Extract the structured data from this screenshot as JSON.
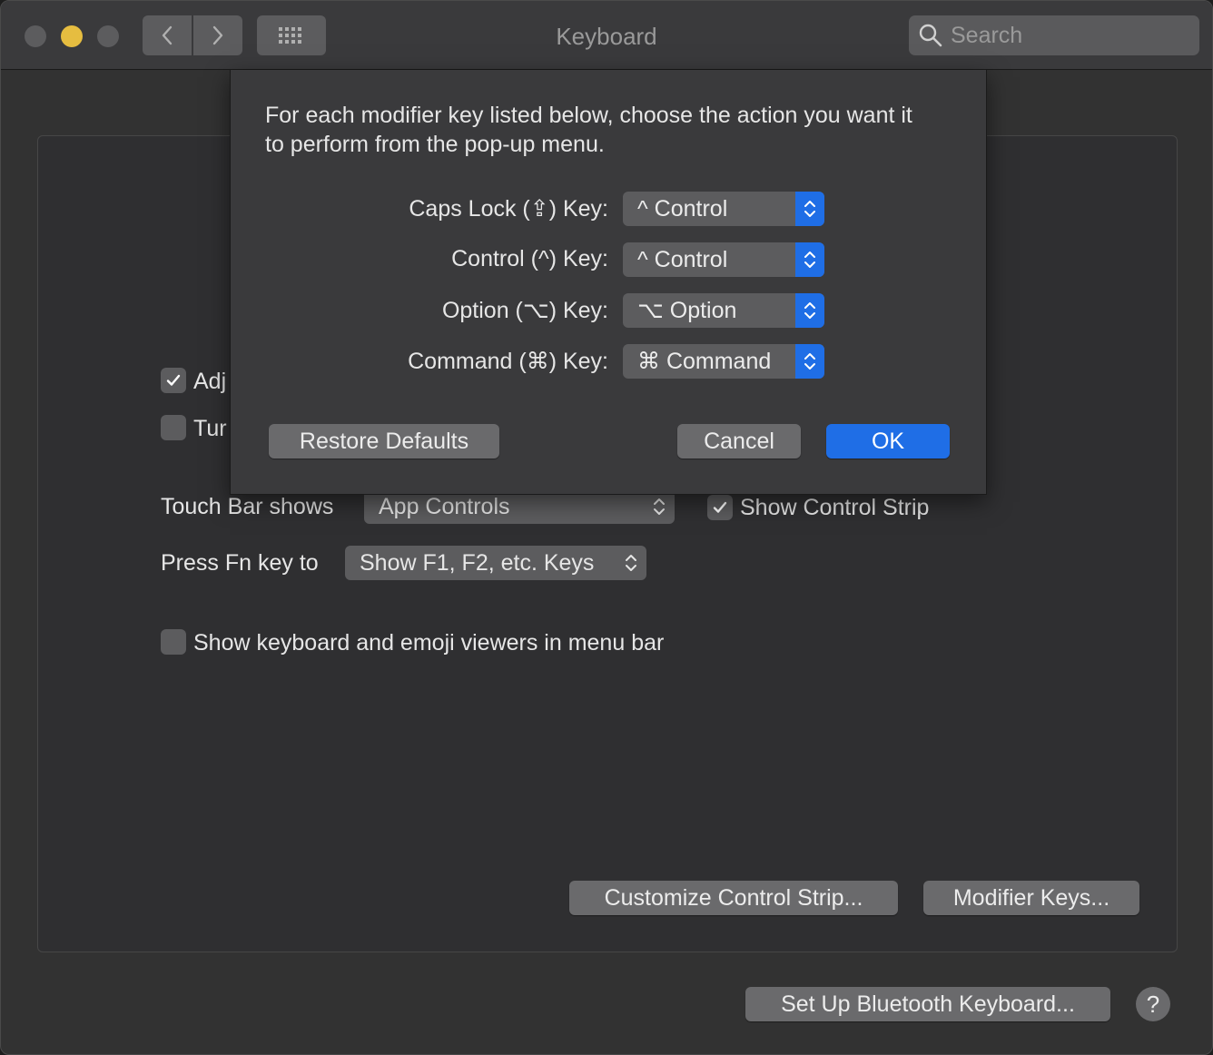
{
  "window": {
    "title": "Keyboard"
  },
  "search": {
    "placeholder": "Search"
  },
  "settings": {
    "adjust_label": "Adj",
    "turn_label": "Tur",
    "touch_bar_label": "Touch Bar shows",
    "touch_bar_value": "App Controls",
    "show_control_strip_label": "Show Control Strip",
    "fn_label": "Press Fn key to",
    "fn_value": "Show F1, F2, etc. Keys",
    "emoji_viewer_label": "Show keyboard and emoji viewers in menu bar",
    "customize_button": "Customize Control Strip...",
    "modifier_button": "Modifier Keys...",
    "bluetooth_button": "Set Up Bluetooth Keyboard...",
    "help_label": "?",
    "adjust_checked": true,
    "turn_checked": false,
    "show_control_strip_checked": true,
    "emoji_viewer_checked": false
  },
  "sheet": {
    "instruction": "For each modifier key listed below, choose the action you want it to perform from the pop-up menu.",
    "rows": [
      {
        "label": "Caps Lock (⇪) Key:",
        "value": "^ Control"
      },
      {
        "label": "Control (^) Key:",
        "value": "^ Control"
      },
      {
        "label": "Option (⌥) Key:",
        "value": "⌥ Option"
      },
      {
        "label": "Command (⌘) Key:",
        "value": "⌘ Command"
      }
    ],
    "restore_button": "Restore Defaults",
    "cancel_button": "Cancel",
    "ok_button": "OK"
  },
  "colors": {
    "accent": "#1f6ee6",
    "minimize_light": "#e6bd40",
    "window_bg": "#323232"
  },
  "icons": {
    "back": "chevron-left-icon",
    "forward": "chevron-right-icon",
    "grid": "grid-icon",
    "search": "search-icon",
    "check": "check-icon",
    "popup": "updown-arrows-icon"
  }
}
